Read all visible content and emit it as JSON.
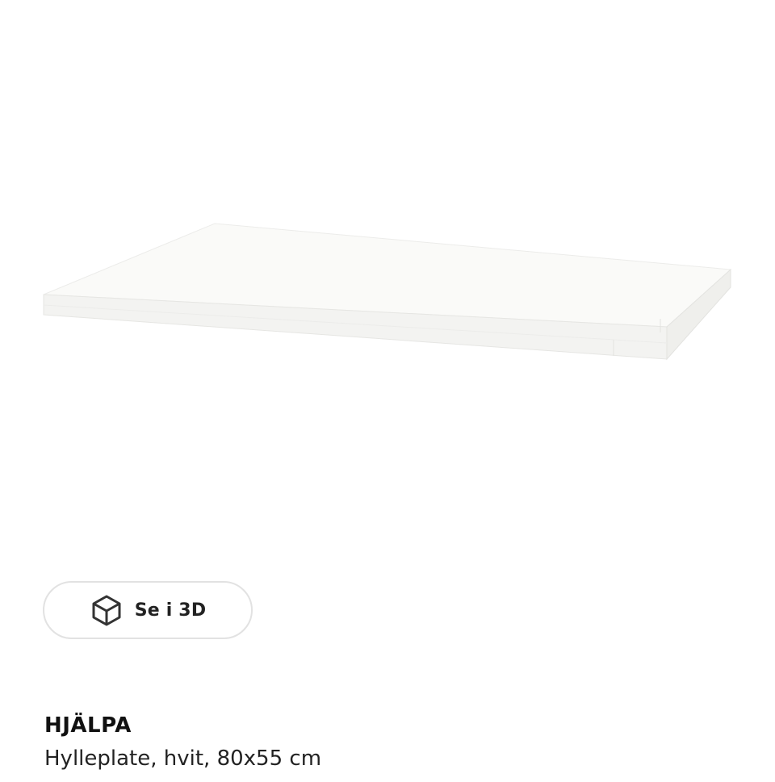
{
  "product": {
    "image_alt": "HJÄLPA Hylleplate, hvit, 80x55 cm",
    "name": "HJÄLPA",
    "description": "Hylleplate, hvit, 80x55 cm",
    "view_3d_label": "Se i 3D",
    "view_3d_icon": "cube-icon"
  }
}
